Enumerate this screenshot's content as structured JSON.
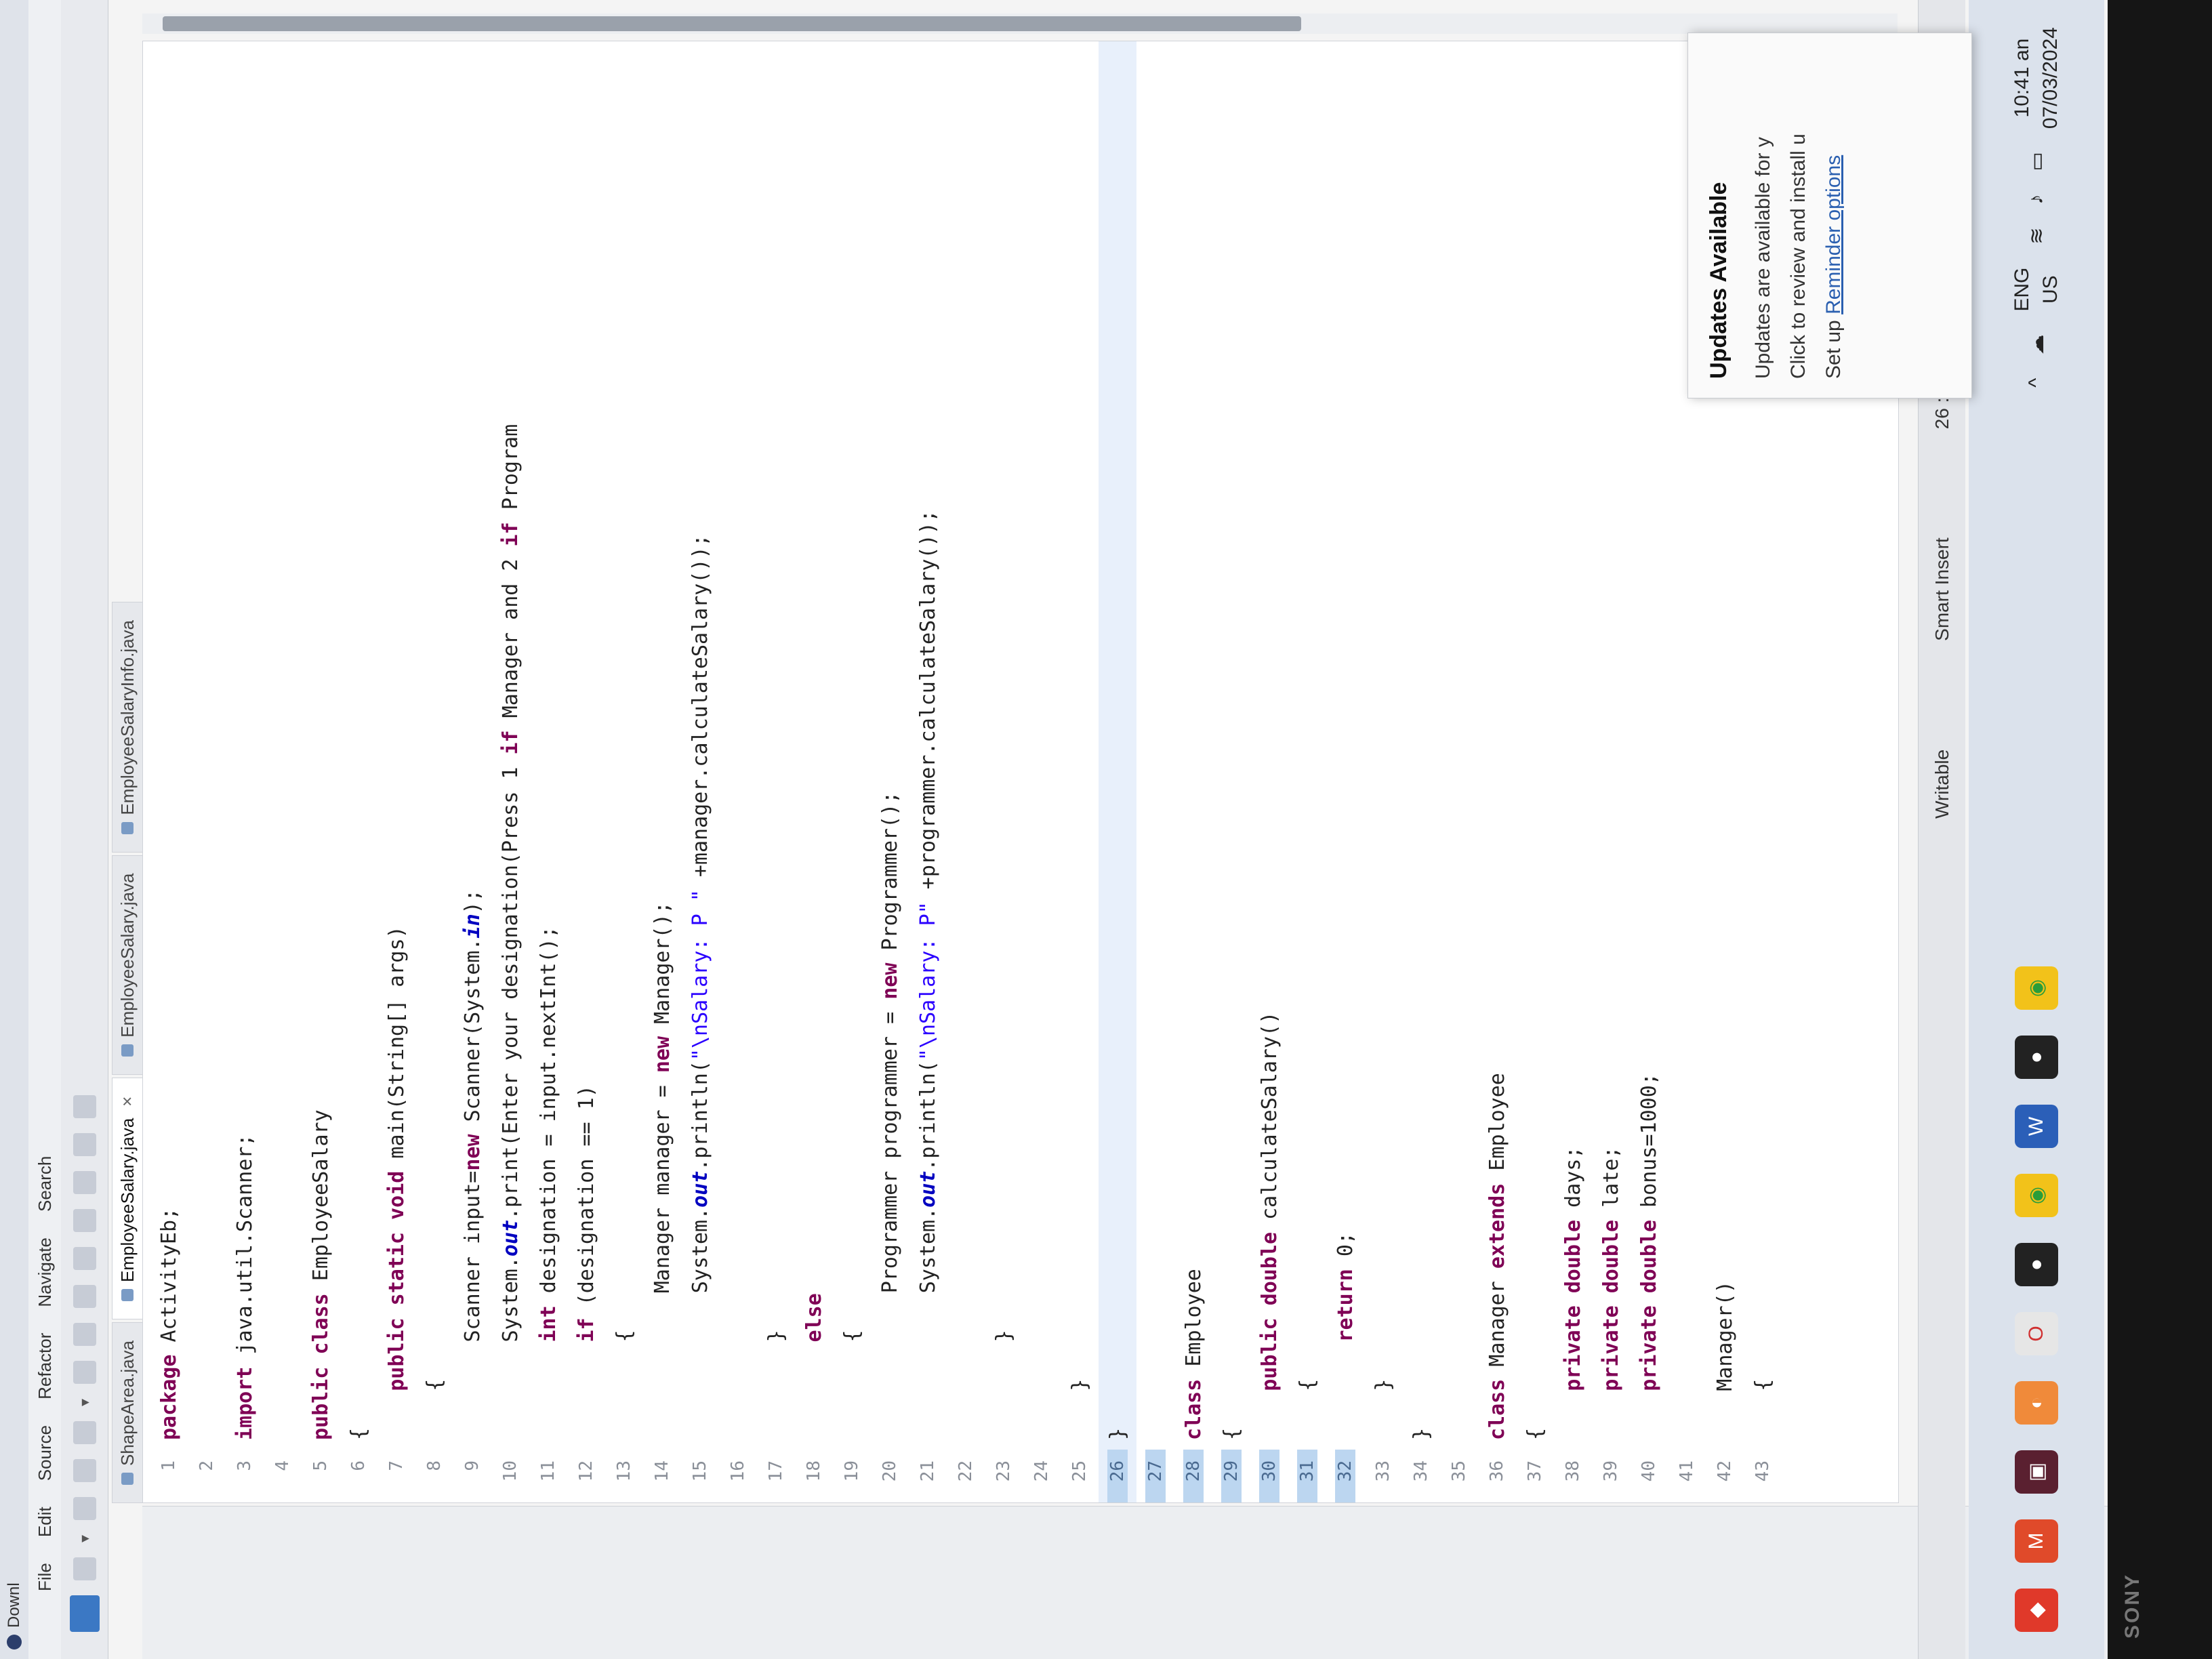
{
  "window": {
    "title": "Downl"
  },
  "menu": [
    "File",
    "Edit",
    "Source",
    "Refactor",
    "Navigate",
    "Search"
  ],
  "tabs": [
    {
      "label": "ShapeArea.java",
      "active": false
    },
    {
      "label": "EmployeeSalary.java",
      "active": true
    },
    {
      "label": "EmployeeSalary.java",
      "active": false
    },
    {
      "label": "EmployeeSalaryInfo.java",
      "active": false
    }
  ],
  "code_lines": [
    {
      "n": "1",
      "text": "package ActivityEb;"
    },
    {
      "n": "2",
      "text": ""
    },
    {
      "n": "3",
      "text": "import java.util.Scanner;"
    },
    {
      "n": "4",
      "text": ""
    },
    {
      "n": "5",
      "text": "public class EmployeeSalary"
    },
    {
      "n": "6",
      "text": "{"
    },
    {
      "n": "7",
      "text": "    public static void main(String[] args)"
    },
    {
      "n": "8",
      "text": "    {"
    },
    {
      "n": "9",
      "text": "        Scanner input=new Scanner(System.in);"
    },
    {
      "n": "10",
      "text": "        System.out.print(\"Enter your designation(Press 1 if Manager and 2 if Program"
    },
    {
      "n": "11",
      "text": "        int designation = input.nextInt();"
    },
    {
      "n": "12",
      "text": "        if (designation == 1)"
    },
    {
      "n": "13",
      "text": "        {"
    },
    {
      "n": "14",
      "text": "            Manager manager = new Manager();"
    },
    {
      "n": "15",
      "text": "            System.out.println(\"\\nSalary: P \" +manager.calculateSalary());"
    },
    {
      "n": "16",
      "text": ""
    },
    {
      "n": "17",
      "text": "        }"
    },
    {
      "n": "18",
      "text": "        else"
    },
    {
      "n": "19",
      "text": "        {"
    },
    {
      "n": "20",
      "text": "            Programmer programmer = new Programmer();"
    },
    {
      "n": "21",
      "text": "            System.out.println(\"\\nSalary: P\" +programmer.calculateSalary());"
    },
    {
      "n": "22",
      "text": ""
    },
    {
      "n": "23",
      "text": "        }"
    },
    {
      "n": "24",
      "text": ""
    },
    {
      "n": "25",
      "text": "    }"
    },
    {
      "n": "26",
      "text": "}"
    },
    {
      "n": "27",
      "text": ""
    },
    {
      "n": "28",
      "text": "class Employee"
    },
    {
      "n": "29",
      "text": "{"
    },
    {
      "n": "30",
      "text": "    public double calculateSalary()"
    },
    {
      "n": "31",
      "text": "    {"
    },
    {
      "n": "32",
      "text": "        return 0;"
    },
    {
      "n": "33",
      "text": "    }"
    },
    {
      "n": "34",
      "text": "}"
    },
    {
      "n": "35",
      "text": ""
    },
    {
      "n": "36",
      "text": "class Manager extends Employee"
    },
    {
      "n": "37",
      "text": "{"
    },
    {
      "n": "38",
      "text": "    private double days;"
    },
    {
      "n": "39",
      "text": "    private double late;"
    },
    {
      "n": "40",
      "text": "    private double bonus=1000;"
    },
    {
      "n": "41",
      "text": ""
    },
    {
      "n": "42",
      "text": "    Manager()"
    },
    {
      "n": "43",
      "text": "    {"
    }
  ],
  "statusbar": {
    "writable": "Writable",
    "insert": "Smart Insert",
    "position": "26 : 1"
  },
  "notification": {
    "title": "Updates Available",
    "line1": "Updates are available for y",
    "line2": "Click to review and install u",
    "link": "Reminder options",
    "link_prefix": "Set up "
  },
  "tray": {
    "lang1": "ENG",
    "lang2": "US",
    "time": "10:41 an",
    "date": "07/03/2024"
  },
  "bezel": {
    "brand": "SONY"
  },
  "colors": {
    "keyword": "#7f0055",
    "string": "#2a00ff",
    "field": "#0000c0",
    "highlight": "#e8f0fb"
  }
}
